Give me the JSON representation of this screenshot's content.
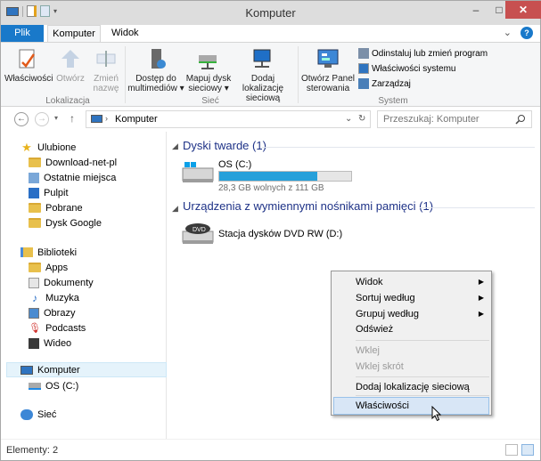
{
  "window": {
    "title": "Komputer"
  },
  "tabs": {
    "file": "Plik",
    "computer": "Komputer",
    "view": "Widok"
  },
  "ribbon": {
    "lokalizacja": {
      "label": "Lokalizacja",
      "properties": "Właściwości",
      "open": "Otwórz",
      "rename_l1": "Zmień",
      "rename_l2": "nazwę"
    },
    "siec": {
      "label": "Sieć",
      "media_l1": "Dostęp do",
      "media_l2": "multimediów",
      "map_l1": "Mapuj dysk",
      "map_l2": "sieciowy",
      "addloc_l1": "Dodaj lokalizację",
      "addloc_l2": "sieciową"
    },
    "system": {
      "label": "System",
      "control_l1": "Otwórz Panel",
      "control_l2": "sterowania",
      "uninstall": "Odinstaluj lub zmień program",
      "sysprops": "Właściwości systemu",
      "manage": "Zarządzaj"
    }
  },
  "address": {
    "path": "Komputer",
    "search_placeholder": "Przeszukaj: Komputer"
  },
  "navpane": {
    "favorites": "Ulubione",
    "fav_items": [
      "Download-net-pl",
      "Ostatnie miejsca",
      "Pulpit",
      "Pobrane",
      "Dysk Google"
    ],
    "libraries": "Biblioteki",
    "lib_items": [
      "Apps",
      "Dokumenty",
      "Muzyka",
      "Obrazy",
      "Podcasts",
      "Wideo"
    ],
    "computer": "Komputer",
    "computer_items": [
      "OS (C:)"
    ],
    "network": "Sieć"
  },
  "content": {
    "hard_drives_header": "Dyski twarde (1)",
    "drive_c": {
      "name": "OS (C:)",
      "free": "28,3 GB wolnych z 111 GB",
      "used_fraction": 0.745
    },
    "removable_header": "Urządzenia z wymiennymi nośnikami pamięci (1)",
    "dvd": {
      "name": "Stacja dysków DVD RW (D:)",
      "badge": "DVD"
    }
  },
  "context_menu": {
    "items": [
      "Widok",
      "Sortuj według",
      "Grupuj według",
      "Odśwież",
      "Wklej",
      "Wklej skrót",
      "Dodaj lokalizację sieciową",
      "Właściwości"
    ]
  },
  "status": {
    "items": "Elementy: 2"
  }
}
